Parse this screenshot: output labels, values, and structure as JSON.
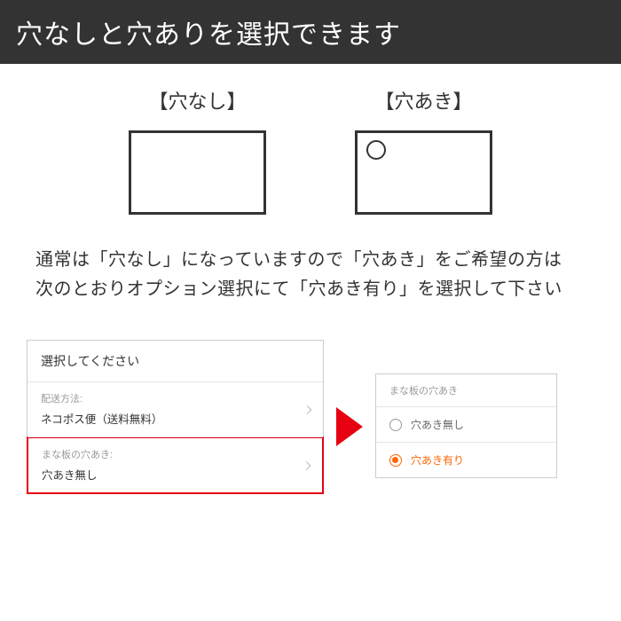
{
  "header": {
    "title": "穴なしと穴ありを選択できます"
  },
  "options": {
    "no_hole_label": "【穴なし】",
    "with_hole_label": "【穴あき】"
  },
  "instruction": {
    "line1": "通常は「穴なし」になっていますので「穴あき」をご希望の方は",
    "line2": "次のとおりオプション選択にて「穴あき有り」を選択して下さい"
  },
  "left_panel": {
    "header": "選択してください",
    "row1_label": "配送方法:",
    "row1_value": "ネコポス便（送料無料）",
    "row2_label": "まな板の穴あき:",
    "row2_value": "穴あき無し"
  },
  "right_panel": {
    "header": "まな板の穴あき",
    "option1": "穴あき無し",
    "option2": "穴あき有り"
  }
}
